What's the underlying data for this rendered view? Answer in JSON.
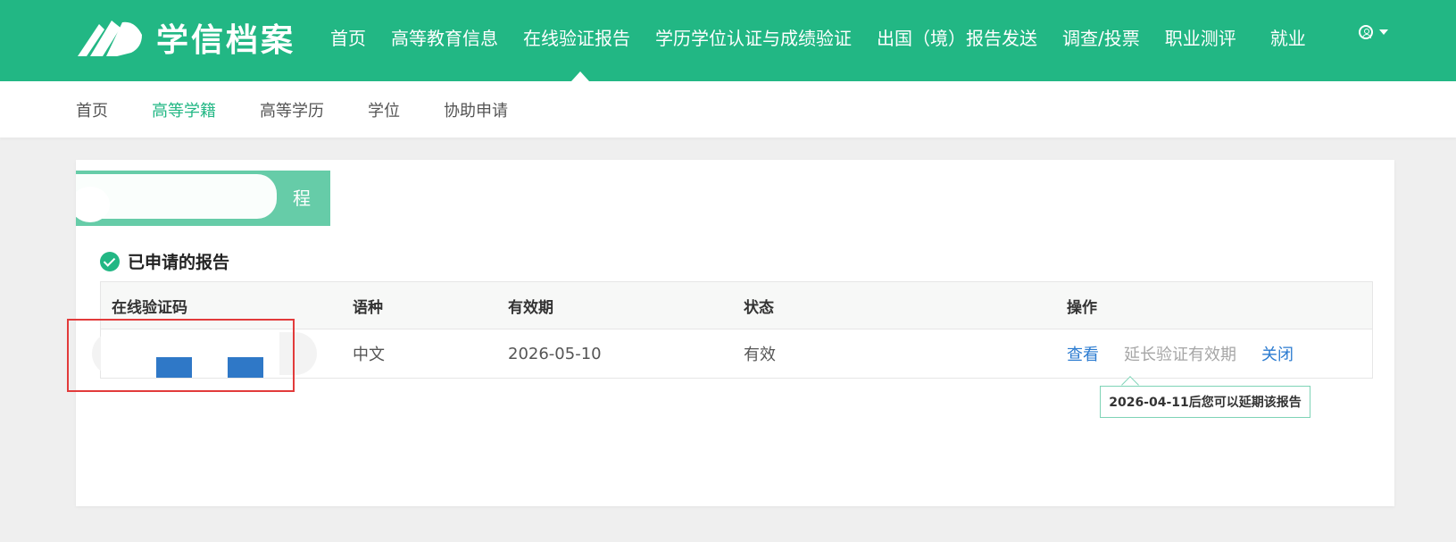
{
  "brand": {
    "name": "学信档案",
    "primary_color": "#22b784",
    "link_color": "#2b7bd0",
    "highlight_color": "#e23b3b"
  },
  "topnav": {
    "items": [
      "首页",
      "高等教育信息",
      "在线验证报告",
      "学历学位认证与成绩验证",
      "出国（境）报告发送",
      "调查/投票",
      "职业测评",
      "就业"
    ],
    "active_index": 2,
    "user_icon": "user-circle-icon"
  },
  "subnav": {
    "items": [
      "首页",
      "高等学籍",
      "高等学历",
      "学位",
      "协助申请"
    ],
    "active_index": 1
  },
  "card": {
    "tab_label": "程",
    "section_title": "已申请的报告",
    "table": {
      "headers": {
        "code": "在线验证码",
        "lang": "语种",
        "valid": "有效期",
        "status": "状态",
        "ops": "操作"
      },
      "rows": [
        {
          "lang": "中文",
          "valid_until": "2026-05-10",
          "status": "有效",
          "ops": {
            "view": "查看",
            "extend": "延长验证有效期",
            "close": "关闭"
          }
        }
      ]
    },
    "tooltip": "2026-04-11后您可以延期该报告"
  }
}
